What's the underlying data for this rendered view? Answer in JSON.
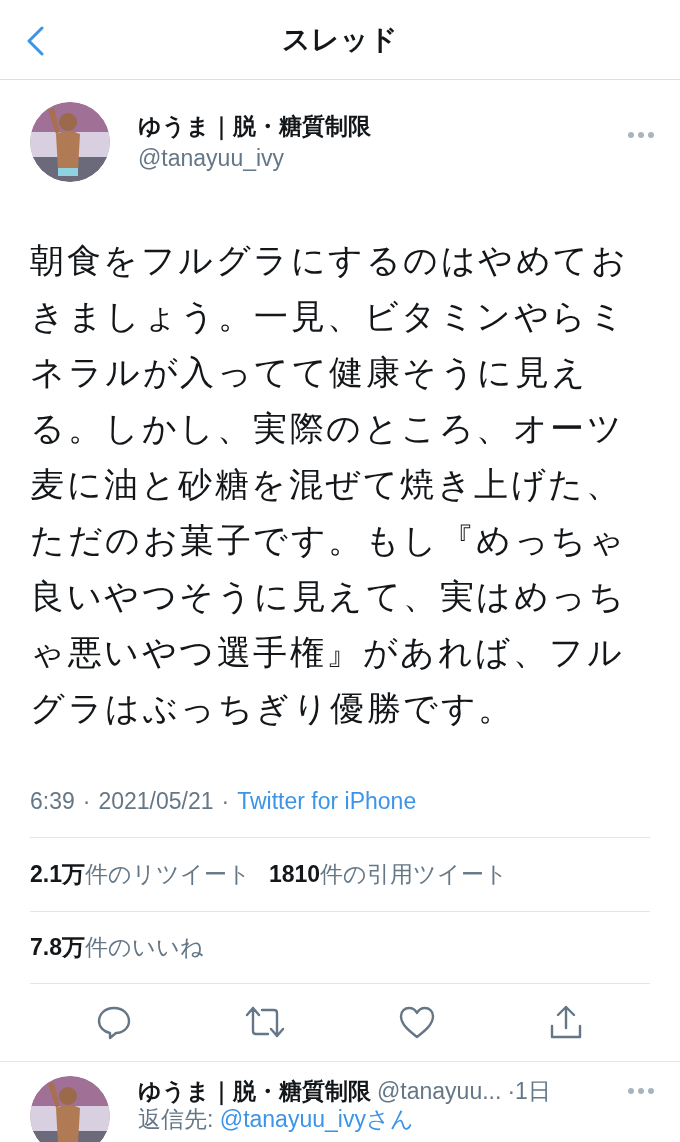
{
  "header": {
    "title": "スレッド"
  },
  "tweet": {
    "author": {
      "name": "ゆうま｜脱・糖質制限",
      "handle": "@tanayuu_ivy"
    },
    "text": "朝食をフルグラにするのはやめておきましょう。一見、ビタミンやらミネラルが入ってて健康そうに見える。しかし、実際のところ、オーツ麦に油と砂糖を混ぜて焼き上げた、ただのお菓子です。もし『めっちゃ良いやつそうに見えて、実はめっちゃ悪いやつ選手権』があれば、フルグラはぶっちぎり優勝です。",
    "time": "6:39",
    "separator": "·",
    "date": "2021/05/21",
    "separator_2": "·",
    "source": "Twitter for iPhone",
    "stats": [
      {
        "count": "2.1万",
        "label": "件のリツイート"
      },
      {
        "count": "1810",
        "label": "件の引用ツイート"
      },
      {
        "count": "7.8万",
        "label": "件のいいね"
      }
    ]
  },
  "reply": {
    "name": "ゆうま｜脱・糖質制限",
    "handle": "@tanayuu...",
    "time": "·1日",
    "reply_to_prefix": "返信先: ",
    "reply_to": "@tanayuu_ivyさん"
  }
}
